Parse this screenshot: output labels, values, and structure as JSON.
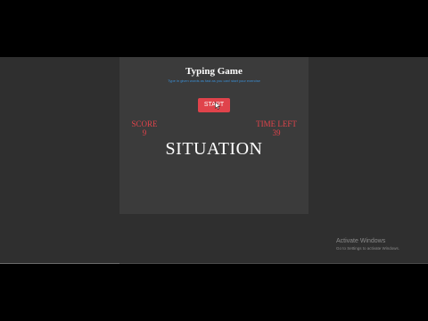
{
  "game": {
    "title": "Typing Game",
    "subtitle": "Type in given words as fast as you can! start your exercise",
    "start_label": "START",
    "score_label": "SCORE",
    "score_value": "9",
    "time_label": "TIME LEFT",
    "time_value": "39",
    "current_word": "SITUATION"
  },
  "os_watermark": {
    "title": "Activate Windows",
    "subtitle": "Go to Settings to activate Windows."
  },
  "video": {
    "progress": 0.28
  },
  "colors": {
    "accent": "#e0434b",
    "subtitle": "#3a8fd6",
    "panel": "#3b3b3b",
    "page": "#2f2f2f"
  }
}
